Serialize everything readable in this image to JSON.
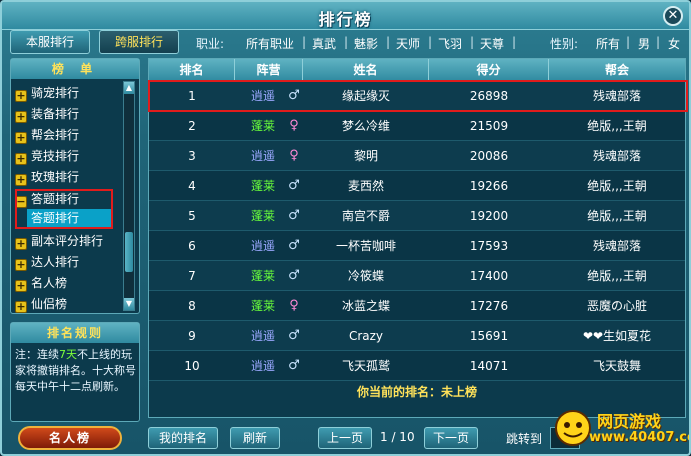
{
  "window": {
    "title": "排行榜"
  },
  "tabs": {
    "server": "本服排行",
    "cross_server": "跨服排行"
  },
  "filters": {
    "profession_label": "职业:",
    "professions": [
      "所有职业",
      "真武",
      "魅影",
      "天师",
      "飞羽",
      "天尊"
    ],
    "gender_label": "性别:",
    "genders": [
      "所有",
      "男",
      "女"
    ]
  },
  "sidebar": {
    "header": "榜 单",
    "items": [
      {
        "label": "骑宠排行",
        "expanded": false
      },
      {
        "label": "装备排行",
        "expanded": false
      },
      {
        "label": "帮会排行",
        "expanded": false
      },
      {
        "label": "竞技排行",
        "expanded": false
      },
      {
        "label": "玫瑰排行",
        "expanded": false
      },
      {
        "label": "答题排行",
        "expanded": true
      },
      {
        "label": "副本评分排行",
        "expanded": false
      },
      {
        "label": "达人排行",
        "expanded": false
      },
      {
        "label": "名人榜",
        "expanded": false
      },
      {
        "label": "仙侣榜",
        "expanded": false
      }
    ],
    "sub_item": "答题排行"
  },
  "rules": {
    "header": "排名规则",
    "text_prefix": "注：连续",
    "text_highlight": "7天",
    "text_suffix": "不上线的玩家将撤销排名。十大称号每天中午十二点刷新。"
  },
  "celebrity_button": "名人榜",
  "table": {
    "columns": [
      "排名",
      "阵营",
      "姓名",
      "得分",
      "帮会"
    ],
    "rows": [
      {
        "rank": "1",
        "faction": "逍遥",
        "gender": "male",
        "name": "缘起缘灭",
        "score": "26898",
        "guild": "残魂部落"
      },
      {
        "rank": "2",
        "faction": "蓬莱",
        "gender": "female",
        "name": "梦么冷维",
        "score": "21509",
        "guild": "绝版,,,王朝"
      },
      {
        "rank": "3",
        "faction": "逍遥",
        "gender": "female",
        "name": "黎明",
        "score": "20086",
        "guild": "残魂部落"
      },
      {
        "rank": "4",
        "faction": "蓬莱",
        "gender": "male",
        "name": "麦西然",
        "score": "19266",
        "guild": "绝版,,,王朝"
      },
      {
        "rank": "5",
        "faction": "蓬莱",
        "gender": "male",
        "name": "南宫不爵",
        "score": "19200",
        "guild": "绝版,,,王朝"
      },
      {
        "rank": "6",
        "faction": "逍遥",
        "gender": "male",
        "name": "一杯苦咖啡",
        "score": "17593",
        "guild": "残魂部落"
      },
      {
        "rank": "7",
        "faction": "蓬莱",
        "gender": "male",
        "name": "冷筱蝶",
        "score": "17400",
        "guild": "绝版,,,王朝"
      },
      {
        "rank": "8",
        "faction": "蓬莱",
        "gender": "female",
        "name": "冰蓝之蝶",
        "score": "17276",
        "guild": "恶魔の心脏"
      },
      {
        "rank": "9",
        "faction": "逍遥",
        "gender": "male",
        "name": "Crazy",
        "score": "15691",
        "guild": "❤❤生如夏花"
      },
      {
        "rank": "10",
        "faction": "逍遥",
        "gender": "male",
        "name": "飞天孤鹫",
        "score": "14071",
        "guild": "飞天鼓舞"
      }
    ],
    "my_rank": "你当前的排名：未上榜"
  },
  "bottom": {
    "my_rank_button": "我的排名",
    "refresh_button": "刷新",
    "prev_button": "上一页",
    "page": "1 / 10",
    "next_button": "下一页",
    "jump_label": "跳转到"
  },
  "watermark": {
    "line1": "网页游戏",
    "line2": "www.40407.com"
  },
  "colors": {
    "highlight_box": "#e01c1c",
    "faction_xiaoyao": "#9aa8ff",
    "faction_penglai": "#6aff3a"
  }
}
